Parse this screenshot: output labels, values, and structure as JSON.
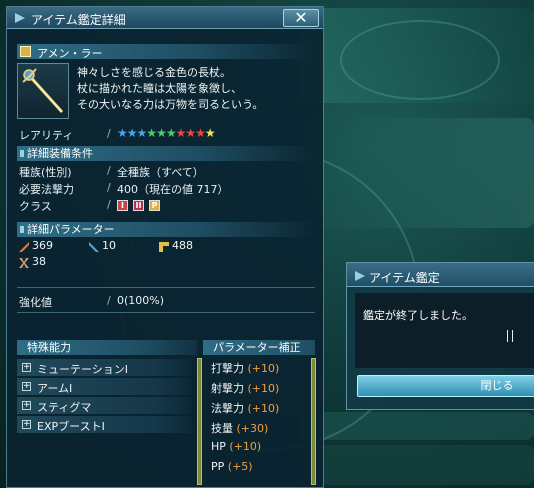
{
  "window": {
    "title": "アイテム鑑定詳細",
    "close_label": "✕"
  },
  "weapon": {
    "name": "アメン・ラー",
    "description": [
      "神々しさを感じる金色の長杖。",
      "杖に描かれた瞳は太陽を象徴し、",
      "その大いなる力は万物を司るという。"
    ]
  },
  "rarity": {
    "label": "レアリティ",
    "stars": 9,
    "star_colors": [
      "#4aa3e8",
      "#4aa3e8",
      "#4aa3e8",
      "#46d06a",
      "#46d06a",
      "#46d06a",
      "#e64848",
      "#e64848",
      "#e64848",
      "#f2e35a"
    ]
  },
  "requirements": {
    "heading": "詳細装備条件",
    "rows": [
      {
        "label": "種族(性別)",
        "value": "全種族（すべて）"
      },
      {
        "label": "必要法撃力",
        "value": "400（現在の値 717）"
      },
      {
        "label": "クラス",
        "value": ""
      }
    ],
    "class_icons": [
      {
        "glyph": "I",
        "color": "#c8454a"
      },
      {
        "glyph": "II",
        "color": "#b0344a"
      },
      {
        "glyph": "P",
        "color": "#d8b24a"
      }
    ]
  },
  "parameters": {
    "heading": "詳細パラメーター",
    "stats": [
      {
        "icon": "melee-attack-icon",
        "value": "369",
        "color": "#e07a3a"
      },
      {
        "icon": "ranged-attack-icon",
        "value": "10",
        "color": "#5aa0d8"
      },
      {
        "icon": "tech-attack-icon",
        "value": "488",
        "color": "#e0c04a"
      },
      {
        "icon": "dexterity-icon",
        "value": "38",
        "color": "#c89a6a"
      }
    ]
  },
  "grind": {
    "label": "強化値",
    "value": "0(100%)"
  },
  "abilities": {
    "heading": "特殊能力",
    "items": [
      "ミューテーションI",
      "アームI",
      "スティグマ",
      "EXPブーストI"
    ]
  },
  "correction": {
    "heading": "パラメーター補正",
    "rows": [
      {
        "label": "打撃力",
        "value": "(+10)"
      },
      {
        "label": "射撃力",
        "value": "(+10)"
      },
      {
        "label": "法撃力",
        "value": "(+10)"
      },
      {
        "label": "技量",
        "value": "(+30)"
      },
      {
        "label": "HP",
        "value": "(+10)"
      },
      {
        "label": "PP",
        "value": "(+5)"
      }
    ]
  },
  "dialog": {
    "title": "アイテム鑑定",
    "message": "鑑定が終了しました。",
    "close_label": "閉じる"
  }
}
